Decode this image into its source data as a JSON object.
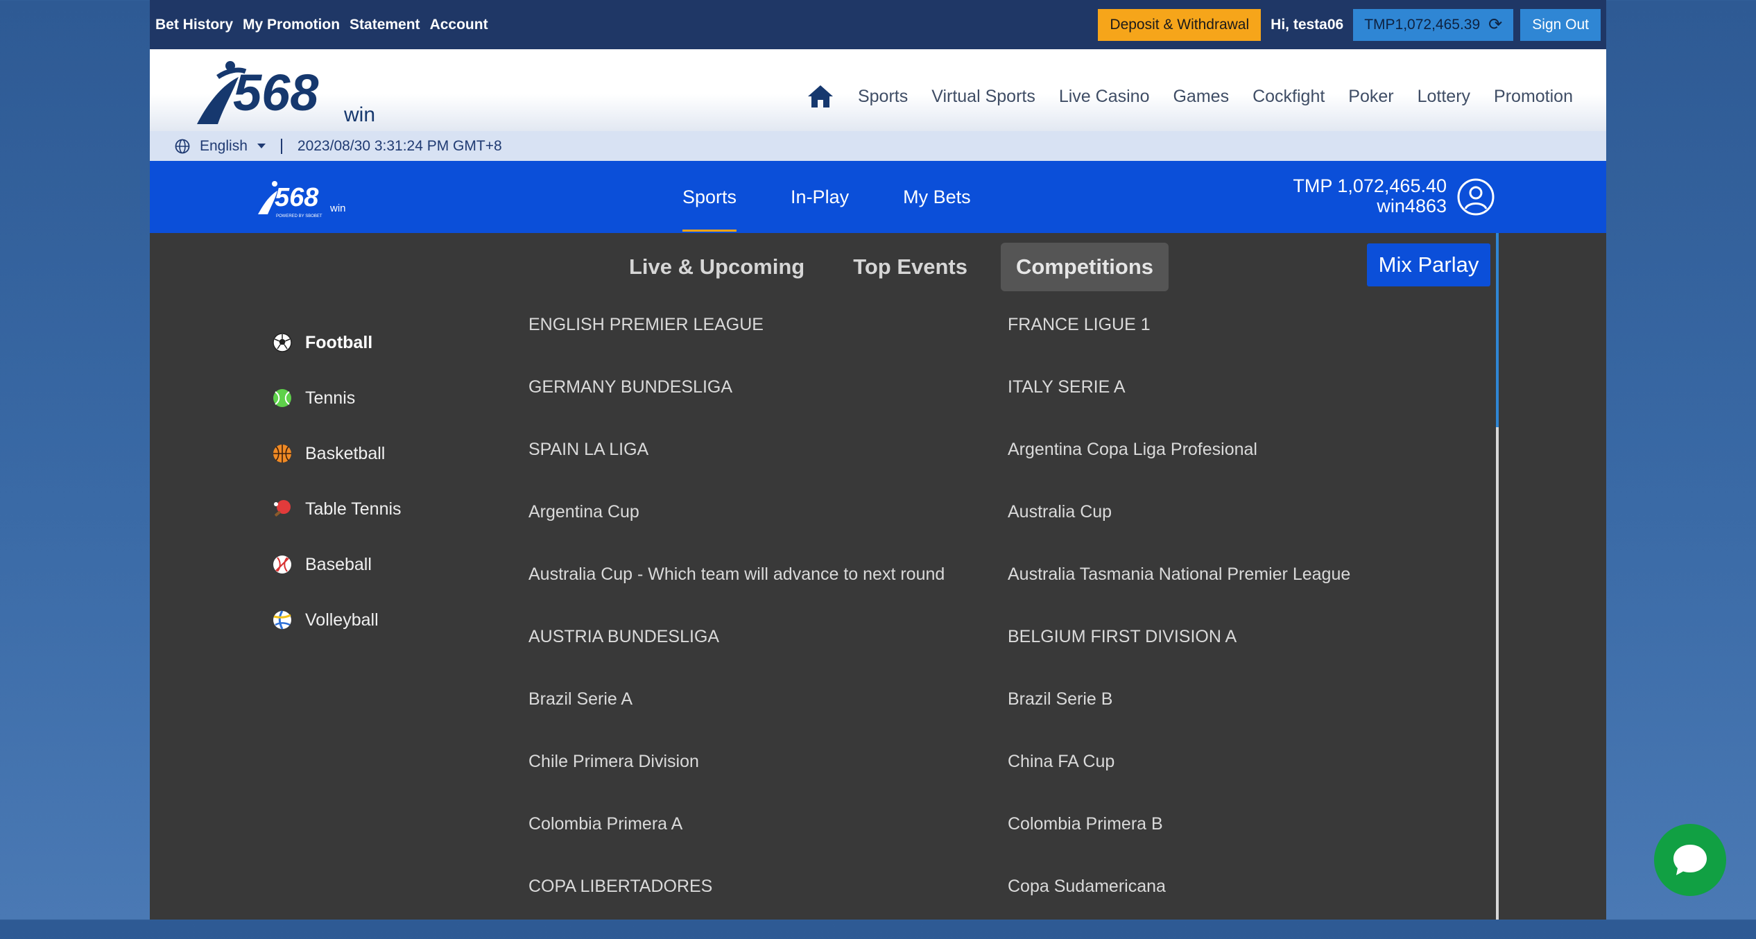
{
  "topbar": {
    "links": [
      "Bet History",
      "My Promotion",
      "Statement",
      "Account"
    ],
    "deposit_label": "Deposit & Withdrawal",
    "greeting": "Hi, testa06",
    "balance": "TMP1,072,465.39",
    "signout_label": "Sign Out"
  },
  "header": {
    "logo_text": "568",
    "logo_suffix": "win",
    "nav": [
      "Sports",
      "Virtual Sports",
      "Live Casino",
      "Games",
      "Cockfight",
      "Poker",
      "Lottery",
      "Promotion"
    ]
  },
  "infobar": {
    "language": "English",
    "datetime": "2023/08/30 3:31:24 PM GMT+8"
  },
  "sportsbook": {
    "logo_text": "568",
    "logo_suffix": "win",
    "logo_tagline": "POWERED BY SBOBET",
    "tabs": [
      "Sports",
      "In-Play",
      "My Bets"
    ],
    "balance": "TMP 1,072,465.40",
    "username": "win4863"
  },
  "subtabs": [
    "Live & Upcoming",
    "Top Events",
    "Competitions"
  ],
  "mix_parlay_label": "Mix Parlay",
  "sports": [
    {
      "label": "Football",
      "icon": "football-icon"
    },
    {
      "label": "Tennis",
      "icon": "tennis-icon"
    },
    {
      "label": "Basketball",
      "icon": "basketball-icon"
    },
    {
      "label": "Table Tennis",
      "icon": "table-tennis-icon"
    },
    {
      "label": "Baseball",
      "icon": "baseball-icon"
    },
    {
      "label": "Volleyball",
      "icon": "volleyball-icon"
    }
  ],
  "competitions": {
    "left": [
      "ENGLISH PREMIER LEAGUE",
      "GERMANY BUNDESLIGA",
      "SPAIN LA LIGA",
      "Argentina Cup",
      "Australia Cup - Which team will advance to next round",
      "AUSTRIA BUNDESLIGA",
      "Brazil Serie A",
      "Chile Primera Division",
      "Colombia Primera A",
      "COPA LIBERTADORES"
    ],
    "right": [
      "FRANCE LIGUE 1",
      "ITALY SERIE A",
      "Argentina Copa Liga Profesional",
      "Australia Cup",
      "Australia Tasmania National Premier League",
      "BELGIUM FIRST DIVISION A",
      "Brazil Serie B",
      "China FA Cup",
      "Colombia Primera B",
      "Copa Sudamericana"
    ]
  },
  "colors": {
    "topbar": "#1f3766",
    "deposit": "#f6a51a",
    "accent_blue": "#0b4fd9",
    "panel": "#393939",
    "chat": "#11a043"
  }
}
